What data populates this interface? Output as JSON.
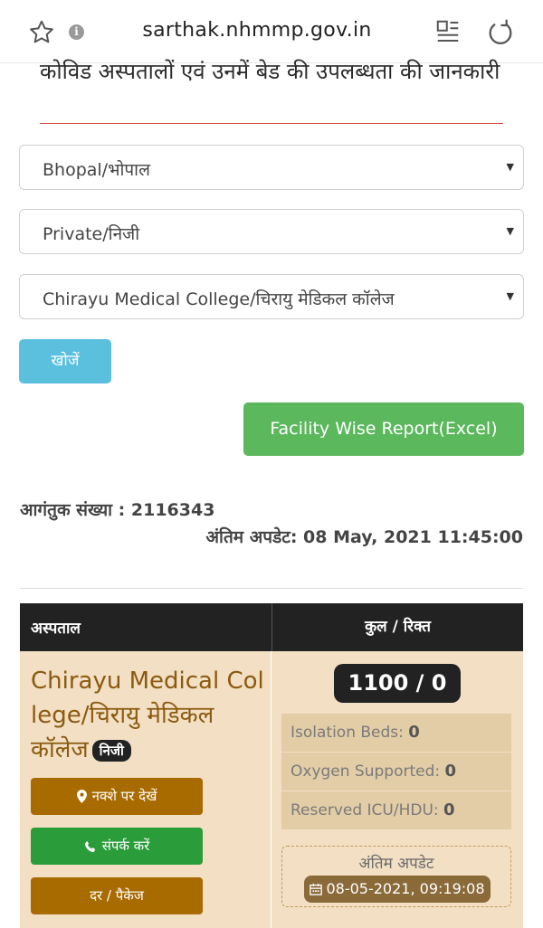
{
  "browser": {
    "url": "sarthak.nhmmp.gov.in",
    "info_glyph": "i",
    "icons": [
      "star-icon",
      "info-icon",
      "reader-mode-icon",
      "reload-icon"
    ]
  },
  "page": {
    "title": "कोविड अस्पतालों एवं उनमें बेड की उपलब्धता की जानकारी"
  },
  "filters": {
    "district": "Bhopal/भोपाल",
    "type": "Private/निजी",
    "hospital": "Chirayu Medical College/चिरायु मेडिकल कॉलेज",
    "caret": "▼"
  },
  "buttons": {
    "search": "खोजें",
    "excel": "Facility Wise Report(Excel)"
  },
  "stats": {
    "visitor_label": "आगंतुक संख्या : 2116343",
    "last_update_label": "अंतिम अपडेट: 08 May, 2021 11:45:00"
  },
  "table": {
    "headers": {
      "hospital": "अस्पताल",
      "total_vacant": "कुल / रिक्त"
    },
    "rows": [
      {
        "hospital_name": "Chirayu Medical College/चिरायु मेडिकल कॉलेज",
        "badge": "निजी",
        "map_button": "नक्शे पर देखें",
        "contact_button": "संपर्क करें",
        "rate_button": "दर / पैकेज",
        "total": "1100 / 0",
        "beds": [
          {
            "label": "Isolation Beds:",
            "value": "0"
          },
          {
            "label": "Oxygen Supported:",
            "value": "0"
          },
          {
            "label": "Reserved ICU/HDU:",
            "value": "0"
          }
        ],
        "update_label": "अंतिम अपडेट",
        "update_time": "08-05-2021, 09:19:08"
      }
    ]
  },
  "colors": {
    "search_button": "#5bc0de",
    "excel_button": "#5cb85c",
    "table_header": "#222222",
    "row_background": "#f2dfc4",
    "hospital_name": "#8b5a10",
    "brown_button": "#a86b00",
    "green_button": "#2a9d3a"
  }
}
